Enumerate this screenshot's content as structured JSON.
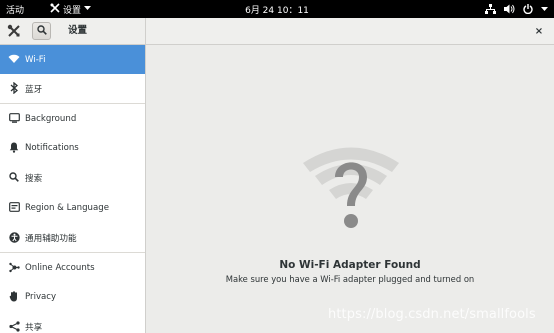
{
  "topbar": {
    "activities_label": "活动",
    "app_menu_label": "设置",
    "clock": "6月 24 10：11",
    "status_icons": [
      "network-icon",
      "volume-icon",
      "power-icon",
      "chevron-down-icon"
    ]
  },
  "header": {
    "title": "设置",
    "close_glyph": "×"
  },
  "sidebar": {
    "items": [
      {
        "label": "Wi-Fi",
        "icon": "wifi-icon",
        "active": true
      },
      {
        "label": "蓝牙",
        "icon": "bluetooth-icon"
      },
      {
        "label": "Background",
        "icon": "background-icon"
      },
      {
        "label": "Notifications",
        "icon": "bell-icon"
      },
      {
        "label": "搜索",
        "icon": "search-icon"
      },
      {
        "label": "Region & Language",
        "icon": "flag-icon"
      },
      {
        "label": "通用辅助功能",
        "icon": "accessibility-icon"
      },
      {
        "label": "Online Accounts",
        "icon": "online-accounts-icon"
      },
      {
        "label": "Privacy",
        "icon": "hand-icon"
      },
      {
        "label": "共享",
        "icon": "share-icon"
      }
    ]
  },
  "main": {
    "graphic": "wifi-question-icon",
    "empty_title": "No Wi-Fi Adapter Found",
    "empty_subtitle": "Make sure you have a Wi-Fi adapter plugged and turned on"
  },
  "watermark": "https://blog.csdn.net/smallfools",
  "colors": {
    "topbar_bg": "#000000",
    "accent": "#4a90d9",
    "sidebar_bg": "#ffffff",
    "main_bg": "#ececea",
    "graphic": "#8a8a8a"
  }
}
